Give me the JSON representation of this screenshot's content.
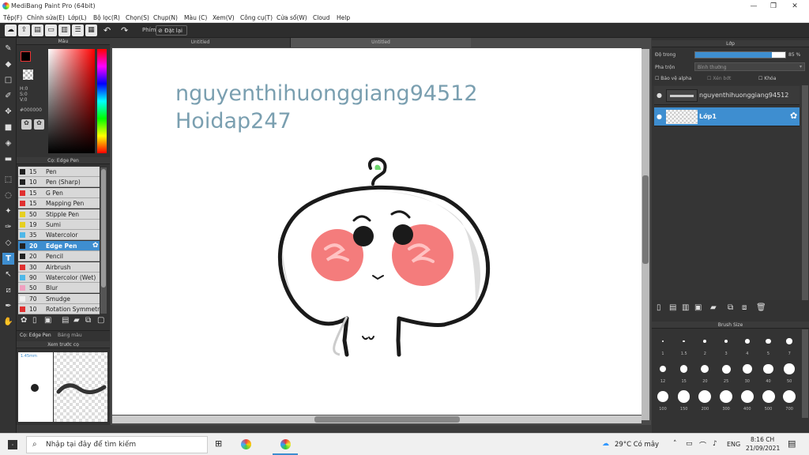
{
  "window": {
    "title": "MediBang Paint Pro (64bit)"
  },
  "menu": [
    "Tệp(F)",
    "Chỉnh sửa(E)",
    "Lớp(L)",
    "Bộ lọc(R)",
    "Chọn(S)",
    "Chụp(N)",
    "Màu (C)",
    "Xem(V)",
    "Công cụ(T)",
    "Cửa sổ(W)",
    "Cloud",
    "Help"
  ],
  "toolbar": {
    "snap_label": "Phím",
    "reset_label": "Đặt lại"
  },
  "tabs": [
    "Untitled",
    "Untitled"
  ],
  "color_panel": {
    "title": "Màu",
    "h": "H:0",
    "s": "S:0",
    "v": "V:0",
    "hex": "#000000"
  },
  "brush_panel": {
    "title": "Cọ: Edge Pen",
    "tab1": "Cọ: Edge Pen",
    "tab2": "Bảng màu",
    "brushes": [
      {
        "size": "15",
        "name": "Pen",
        "color": "#222222"
      },
      {
        "size": "10",
        "name": "Pen (Sharp)",
        "color": "#222222"
      },
      {
        "size": "15",
        "name": "G Pen",
        "color": "#e03030"
      },
      {
        "size": "15",
        "name": "Mapping Pen",
        "color": "#e03030"
      },
      {
        "size": "50",
        "name": "Stipple Pen",
        "color": "#e6d020"
      },
      {
        "size": "19",
        "name": "Sumi",
        "color": "#e6d020"
      },
      {
        "size": "35",
        "name": "Watercolor",
        "color": "#4fb8e8"
      },
      {
        "size": "20",
        "name": "Edge Pen",
        "color": "#222222"
      },
      {
        "size": "20",
        "name": "Pencil",
        "color": "#222222"
      },
      {
        "size": "30",
        "name": "Airbrush",
        "color": "#e03030"
      },
      {
        "size": "90",
        "name": "Watercolor (Wet)",
        "color": "#4fb8e8"
      },
      {
        "size": "50",
        "name": "Blur",
        "color": "#f0a0c0"
      },
      {
        "size": "70",
        "name": "Smudge",
        "color": "#f0f0f0"
      },
      {
        "size": "10",
        "name": "Rotation Symmetry",
        "color": "#e03030"
      }
    ]
  },
  "preview_panel": {
    "title": "Xem trước cọ",
    "size": "1.45mm"
  },
  "canvas_text": {
    "line1": "nguyenthihuonggiang94512",
    "line2": "Hoidap247"
  },
  "layer_panel": {
    "title": "Lớp",
    "opacity_label": "Độ trong",
    "opacity_value": "85 %",
    "opacity_fraction": 0.85,
    "blend_label": "Pha trộn",
    "blend_value": "Bình thường",
    "protect_alpha": "Bảo vệ alpha",
    "clip": "Xén bớt",
    "lock": "Khóa",
    "layers": [
      {
        "name": "nguyenthihuonggiang94512"
      },
      {
        "name": "Lớp1"
      }
    ]
  },
  "brush_size_panel": {
    "title": "Brush Size",
    "sizes": [
      "1",
      "1.5",
      "2",
      "3",
      "4",
      "5",
      "7",
      "12",
      "15",
      "20",
      "25",
      "30",
      "40",
      "50",
      "100",
      "150",
      "200",
      "300",
      "400",
      "500",
      "700"
    ]
  },
  "taskbar": {
    "search": "Nhập tại đây để tìm kiếm",
    "weather": "29°C Có mây",
    "lang": "ENG",
    "time": "8:16 CH",
    "date": "21/09/2021"
  },
  "colors": {
    "accent": "#3e8ed0",
    "canvas_text": "#7a9fb0",
    "blush": "#f47c7c"
  }
}
